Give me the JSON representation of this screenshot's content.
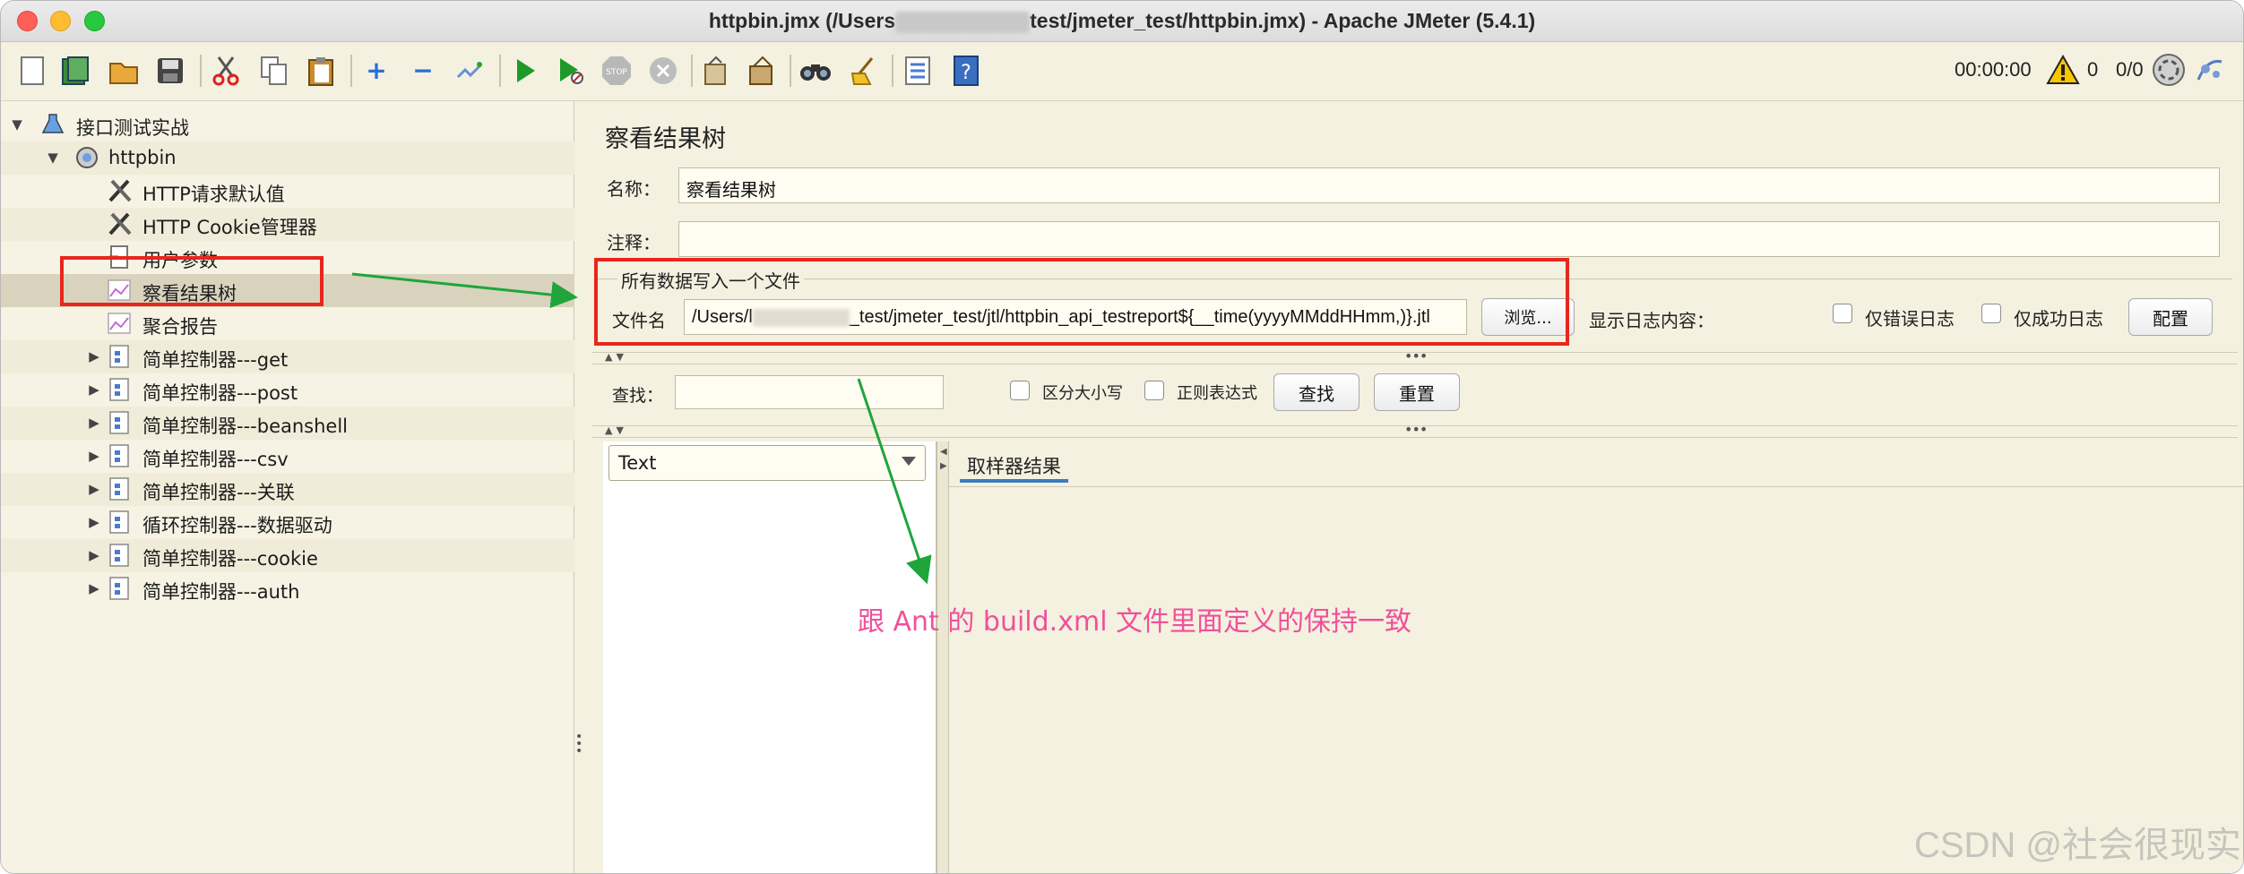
{
  "window": {
    "title_prefix": "httpbin.jmx (/Users",
    "title_suffix": "test/jmeter_test/httpbin.jmx) - Apache JMeter (5.4.1)"
  },
  "toolbar": {
    "elapsed_time": "00:00:00",
    "warning_count": "0",
    "thread_ratio": "0/0",
    "icons": [
      "new-icon",
      "templates-icon",
      "open-icon",
      "save-icon",
      "cut-icon",
      "copy-icon",
      "paste-icon",
      "expand-icon",
      "collapse-icon",
      "toggle-icon",
      "start-icon",
      "start-no-pause-icon",
      "stop-icon",
      "shutdown-icon",
      "clear-icon",
      "clear-all-icon",
      "search-icon",
      "reset-search-icon",
      "function-helper-icon",
      "help-icon"
    ]
  },
  "tree": {
    "items": [
      {
        "label": "接口测试实战",
        "icon": "test-plan-icon",
        "level": 0,
        "arrow": "down"
      },
      {
        "label": "httpbin",
        "icon": "thread-group-icon",
        "level": 1,
        "arrow": "down"
      },
      {
        "label": "HTTP请求默认值",
        "icon": "config-element-icon",
        "level": 2,
        "arrow": ""
      },
      {
        "label": "HTTP Cookie管理器",
        "icon": "config-element-icon",
        "level": 2,
        "arrow": ""
      },
      {
        "label": "用户参数",
        "icon": "pre-processor-icon",
        "level": 2,
        "arrow": ""
      },
      {
        "label": "察看结果树",
        "icon": "listener-icon",
        "level": 2,
        "arrow": ""
      },
      {
        "label": "聚合报告",
        "icon": "listener-icon",
        "level": 2,
        "arrow": ""
      },
      {
        "label": "简单控制器---get",
        "icon": "controller-icon",
        "level": 2,
        "arrow": "right"
      },
      {
        "label": "简单控制器---post",
        "icon": "controller-icon",
        "level": 2,
        "arrow": "right"
      },
      {
        "label": "简单控制器---beanshell",
        "icon": "controller-icon",
        "level": 2,
        "arrow": "right"
      },
      {
        "label": "简单控制器---csv",
        "icon": "controller-icon",
        "level": 2,
        "arrow": "right"
      },
      {
        "label": "简单控制器---关联",
        "icon": "controller-icon",
        "level": 2,
        "arrow": "right"
      },
      {
        "label": "循环控制器---数据驱动",
        "icon": "controller-icon",
        "level": 2,
        "arrow": "right"
      },
      {
        "label": "简单控制器---cookie",
        "icon": "controller-icon",
        "level": 2,
        "arrow": "right"
      },
      {
        "label": "简单控制器---auth",
        "icon": "controller-icon",
        "level": 2,
        "arrow": "right"
      }
    ],
    "selected_index": 5
  },
  "panel": {
    "title": "察看结果树",
    "name_label": "名称：",
    "name_value": "察看结果树",
    "comment_label": "注释：",
    "comment_value": "",
    "file_group_title": "所有数据写入一个文件",
    "filename_label": "文件名",
    "filename_prefix": "/Users/l",
    "filename_suffix": "_test/jmeter_test/jtl/httpbin_api_testreport${__time(yyyyMMddHHmm,)}.jtl",
    "browse_button": "浏览...",
    "log_display_label": "显示日志内容：",
    "errors_only_label": "仅错误日志",
    "success_only_label": "仅成功日志",
    "configure_button": "配置",
    "search_label": "查找：",
    "search_value": "",
    "case_sensitive_label": "区分大小写",
    "regex_label": "正则表达式",
    "find_button": "查找",
    "reset_button": "重置",
    "renderer_selected": "Text",
    "sampler_result_tab": "取样器结果"
  },
  "annotation": {
    "note": "跟 Ant 的 build.xml 文件里面定义的保持一致",
    "color": "#f0509a",
    "highlight_color": "#e8261c",
    "arrow_color": "#1fa53a"
  },
  "watermark": "CSDN @社会很现实"
}
